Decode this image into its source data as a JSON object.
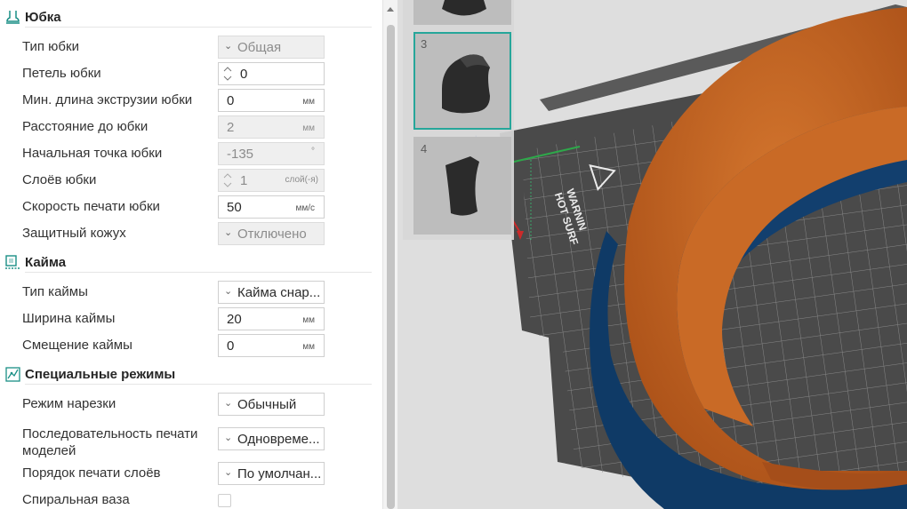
{
  "sections": [
    {
      "title": "Юбка",
      "icon": "skirt-icon",
      "rows": [
        {
          "label": "Тип юбки",
          "kind": "select",
          "value": "Общая",
          "disabled": true
        },
        {
          "label": "Петель юбки",
          "kind": "spin",
          "value": "0",
          "disabled": false
        },
        {
          "label": "Мин. длина экструзии юбки",
          "kind": "text",
          "value": "0",
          "unit": "мм",
          "disabled": false
        },
        {
          "label": "Расстояние до юбки",
          "kind": "text",
          "value": "2",
          "unit": "мм",
          "disabled": true
        },
        {
          "label": "Начальная точка юбки",
          "kind": "text",
          "value": "-135",
          "unit": "°",
          "disabled": true
        },
        {
          "label": "Слоёв юбки",
          "kind": "spin",
          "value": "1",
          "unit": "слой(-я)",
          "disabled": true
        },
        {
          "label": "Скорость печати юбки",
          "kind": "text",
          "value": "50",
          "unit": "мм/с",
          "disabled": false
        },
        {
          "label": "Защитный кожух",
          "kind": "select",
          "value": "Отключено",
          "disabled": true
        }
      ]
    },
    {
      "title": "Кайма",
      "icon": "brim-icon",
      "rows": [
        {
          "label": "Тип каймы",
          "kind": "select",
          "value": "Кайма снар...",
          "disabled": false
        },
        {
          "label": "Ширина каймы",
          "kind": "text",
          "value": "20",
          "unit": "мм",
          "disabled": false
        },
        {
          "label": "Смещение каймы",
          "kind": "text",
          "value": "0",
          "unit": "мм",
          "disabled": false
        }
      ]
    },
    {
      "title": "Специальные режимы",
      "icon": "special-mode-icon",
      "rows": [
        {
          "label": "Режим нарезки",
          "kind": "select",
          "value": "Обычный",
          "disabled": false
        },
        {
          "label": "Последовательность печати моделей",
          "kind": "select",
          "value": "Одновреме...",
          "disabled": false,
          "two_line": true
        },
        {
          "label": "Порядок печати слоёв",
          "kind": "select",
          "value": "По умолчан...",
          "disabled": false
        },
        {
          "label": "Спиральная ваза",
          "kind": "checkbox",
          "checked": false
        }
      ]
    }
  ],
  "plates": [
    {
      "number": "",
      "selected": false
    },
    {
      "number": "3",
      "selected": true
    },
    {
      "number": "4",
      "selected": false
    }
  ],
  "bed_text": {
    "line1": "WARNIN",
    "line2": "HOT SURF"
  },
  "colors": {
    "accent": "#26a69a",
    "model_orange": "#c0601e",
    "model_blue": "#0f3a66",
    "bed_dark": "#4a4a4a"
  }
}
